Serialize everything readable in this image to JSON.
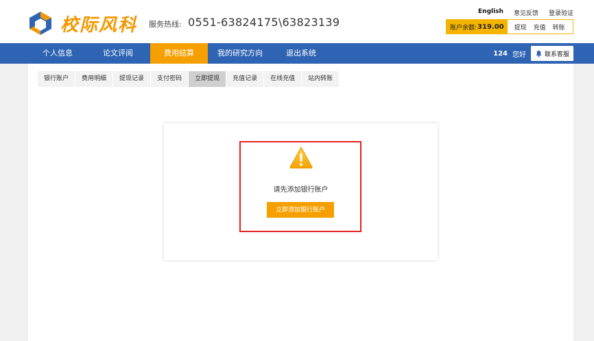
{
  "header": {
    "brand": "校际风科",
    "hotline_label": "服务热线:",
    "hotline_number": "0551-63824175\\63823139",
    "links": [
      "English",
      "意见反馈",
      "登录验证"
    ],
    "balance_label": "账户余额:",
    "balance_value": "319.00",
    "balance_actions": [
      "提现",
      "充值",
      "转账"
    ]
  },
  "nav": {
    "items": [
      "个人信息",
      "论文评阅",
      "费用结算",
      "我的研究方向",
      "退出系统"
    ],
    "active": "费用结算",
    "user_count": "124",
    "greeting": "您好",
    "service_label": "联系客服"
  },
  "subtabs": {
    "items": [
      "银行账户",
      "费用明细",
      "提现记录",
      "支付密码",
      "立即提现",
      "充值记录",
      "在线充值",
      "站内转账"
    ],
    "active": "立即提现"
  },
  "notice": {
    "message": "请先添加银行账户",
    "button_label": "立即添加银行账户"
  },
  "colors": {
    "nav_bg": "#2e64b3",
    "accent": "#f5a000",
    "highlight_border": "#e52020"
  }
}
